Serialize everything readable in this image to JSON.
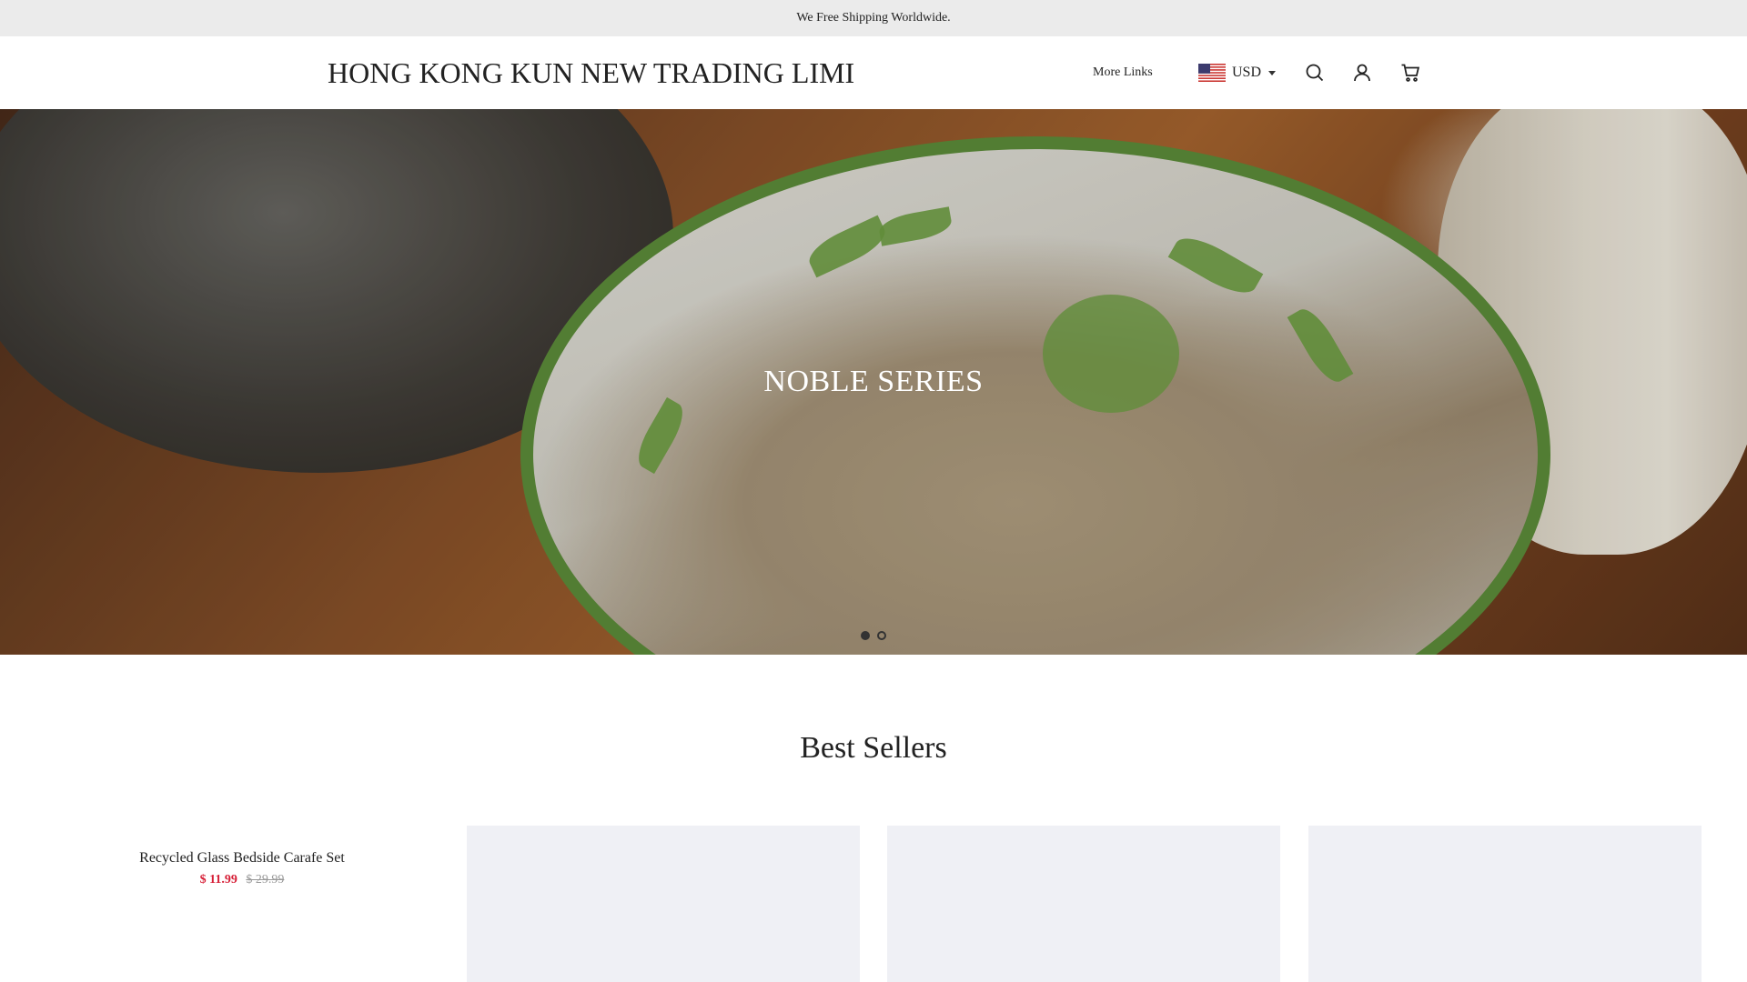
{
  "announcement": {
    "text": "We Free Shipping Worldwide."
  },
  "header": {
    "logo": "HONG KONG KUN NEW TRADING LIMI",
    "more_links": "More Links",
    "currency": {
      "code": "USD",
      "flag_icon": "us-flag-icon"
    },
    "icons": [
      "search-icon",
      "account-icon",
      "cart-icon"
    ]
  },
  "hero": {
    "title": "NOBLE SERIES",
    "slides_total": 2,
    "active_slide": 1
  },
  "best_sellers": {
    "title": "Best Sellers",
    "products": [
      {
        "name": "Recycled Glass Bedside Carafe Set",
        "price": "$ 11.99",
        "compare_price": "$ 29.99"
      },
      {
        "name": ""
      },
      {
        "name": ""
      },
      {
        "name": ""
      }
    ]
  },
  "colors": {
    "announcement_bg": "#ebebeb",
    "sale_price": "#d61e36",
    "placeholder_card": "#eff0f5"
  }
}
